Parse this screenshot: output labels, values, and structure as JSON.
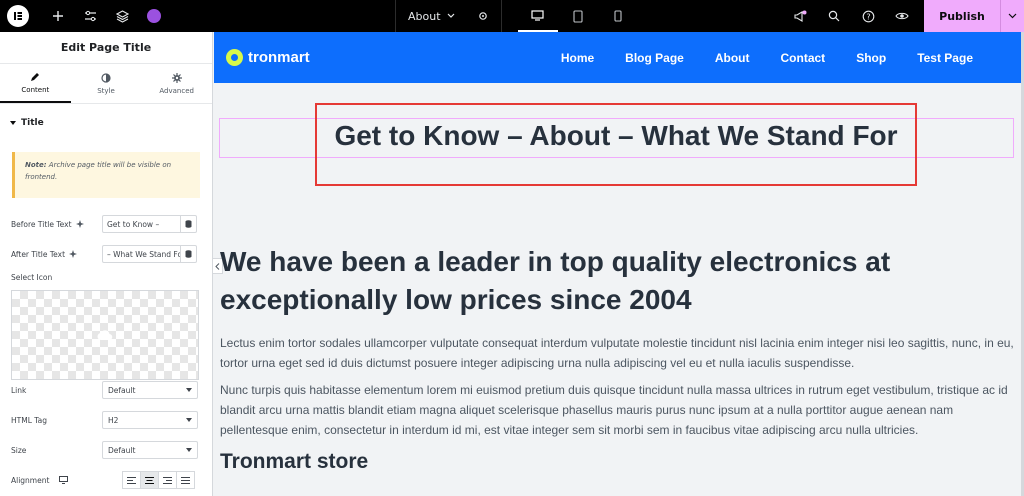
{
  "topbar": {
    "page_selector": "About",
    "publish_label": "Publish"
  },
  "panel": {
    "title": "Edit Page Title",
    "tabs": [
      {
        "label": "Content",
        "icon": "pencil-icon"
      },
      {
        "label": "Style",
        "icon": "contrast-icon"
      },
      {
        "label": "Advanced",
        "icon": "gear-icon"
      }
    ],
    "section_title": "Title",
    "note_bold": "Note:",
    "note_text": " Archive page title will be visible on frontend.",
    "before_title": {
      "label": "Before Title Text",
      "value": "Get to Know –"
    },
    "after_title": {
      "label": "After Title Text",
      "value": "– What We Stand For"
    },
    "select_icon_label": "Select Icon",
    "link": {
      "label": "Link",
      "value": "Default"
    },
    "html_tag": {
      "label": "HTML Tag",
      "value": "H2"
    },
    "size": {
      "label": "Size",
      "value": "Default"
    },
    "alignment_label": "Alignment"
  },
  "site": {
    "logo": "tronmart",
    "nav": [
      "Home",
      "Blog Page",
      "About",
      "Contact",
      "Shop",
      "Test Page"
    ],
    "page_title": "Get to Know – About – What We Stand For",
    "heading": "We have been a leader in top quality electronics at exceptionally low prices since 2004",
    "para1": "Lectus enim tortor sodales ullamcorper vulputate consequat interdum vulputate molestie tincidunt nisl lacinia enim integer nisi leo sagittis, nunc, in eu, tortor urna eget sed id duis dictumst posuere integer adipiscing urna nulla adipiscing vel eu et nulla iaculis suspendisse.",
    "para2": "Nunc turpis quis habitasse elementum lorem mi euismod pretium duis quisque tincidunt nulla massa ultrices in rutrum eget vestibulum, tristique ac id blandit arcu urna mattis blandit etiam magna aliquet scelerisque phasellus mauris purus nunc ipsum at a nulla porttitor augue aenean nam pellentesque enim, consectetur in interdum id mi, est vitae integer sem sit morbi sem in faucibus vitae adipiscing arcu nulla ultricies.",
    "subheading": "Tronmart store"
  },
  "colors": {
    "header_blue": "#0d6efd",
    "publish_pink": "#f0abfc",
    "highlight_red": "#e53935"
  }
}
